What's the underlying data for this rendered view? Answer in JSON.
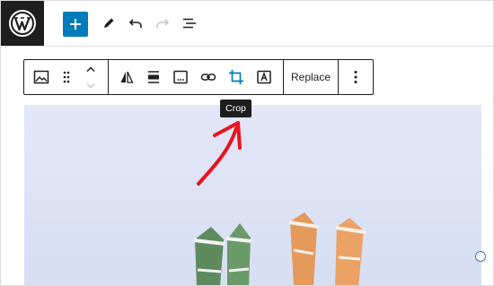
{
  "topbar": {
    "logo_icon": "wordpress-logo-icon",
    "add_block_icon": "plus-icon",
    "tools_icon": "pencil-icon",
    "undo_icon": "undo-icon",
    "redo_icon": "redo-icon",
    "list_view_icon": "list-view-icon"
  },
  "block_toolbar": {
    "block_type_icon": "image-icon",
    "drag_icon": "drag-handle-icon",
    "move_up_icon": "chevron-up-icon",
    "move_down_icon": "chevron-down-icon",
    "duotone_icon": "duotone-icon",
    "align_icon": "align-icon",
    "caption_icon": "caption-icon",
    "link_icon": "link-icon",
    "crop_icon": "crop-icon",
    "text_overlay_icon": "text-over-image-icon",
    "replace_label": "Replace",
    "options_icon": "more-vertical-icon"
  },
  "tooltip": {
    "text": "Crop"
  },
  "colors": {
    "accent": "#007cba",
    "dark": "#1e1e1e",
    "annotation": "#e8141e",
    "photo_bg": "#dde3f5"
  }
}
